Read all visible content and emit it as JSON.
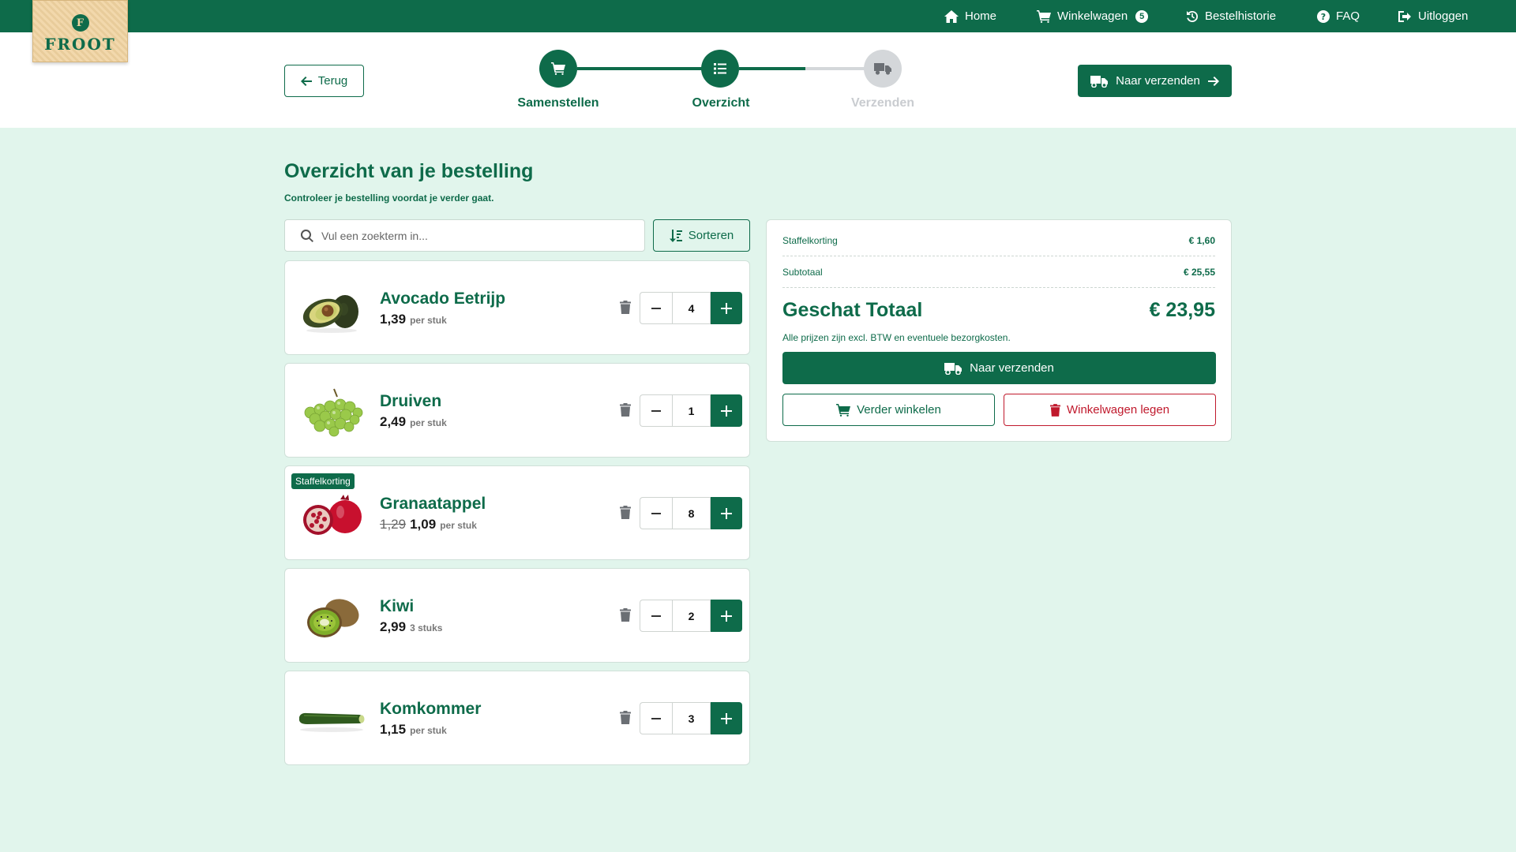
{
  "nav": {
    "home": "Home",
    "cart": "Winkelwagen",
    "cart_count": "5",
    "history": "Bestelhistorie",
    "faq": "FAQ",
    "logout": "Uitloggen"
  },
  "logo": {
    "mark": "F",
    "text": "FROOT"
  },
  "header": {
    "back": "Terug",
    "ship": "Naar verzenden",
    "steps": [
      {
        "label": "Samenstellen",
        "state": "active",
        "icon": "cart-icon"
      },
      {
        "label": "Overzicht",
        "state": "active",
        "icon": "list-icon"
      },
      {
        "label": "Verzenden",
        "state": "inactive",
        "icon": "truck-icon"
      }
    ]
  },
  "main": {
    "title": "Overzicht van je bestelling",
    "subtitle": "Controleer je bestelling voordat je verder gaat.",
    "search_placeholder": "Vul een zoekterm in...",
    "sort": "Sorteren"
  },
  "items": [
    {
      "name": "Avocado Eetrijp",
      "price": "1,39",
      "old_price": "",
      "unit": "per stuk",
      "qty": "4",
      "tag": ""
    },
    {
      "name": "Druiven",
      "price": "2,49",
      "old_price": "",
      "unit": "per stuk",
      "qty": "1",
      "tag": ""
    },
    {
      "name": "Granaatappel",
      "price": "1,09",
      "old_price": "1,29",
      "unit": "per stuk",
      "qty": "8",
      "tag": "Staffelkorting"
    },
    {
      "name": "Kiwi",
      "price": "2,99",
      "old_price": "",
      "unit": "3 stuks",
      "qty": "2",
      "tag": ""
    },
    {
      "name": "Komkommer",
      "price": "1,15",
      "old_price": "",
      "unit": "per stuk",
      "qty": "3",
      "tag": ""
    }
  ],
  "summary": {
    "discount_label": "Staffelkorting",
    "discount_value": "€ 1,60",
    "subtotal_label": "Subtotaal",
    "subtotal_value": "€ 25,55",
    "total_label": "Geschat Totaal",
    "total_value": "€ 23,95",
    "note": "Alle prijzen zijn excl. BTW en eventuele bezorgkosten.",
    "ship": "Naar verzenden",
    "continue": "Verder winkelen",
    "empty": "Winkelwagen legen"
  },
  "colors": {
    "brand": "#0e6b4a",
    "background": "#e1f5ec",
    "danger": "#c0192c",
    "inactive": "#d4d7da"
  }
}
